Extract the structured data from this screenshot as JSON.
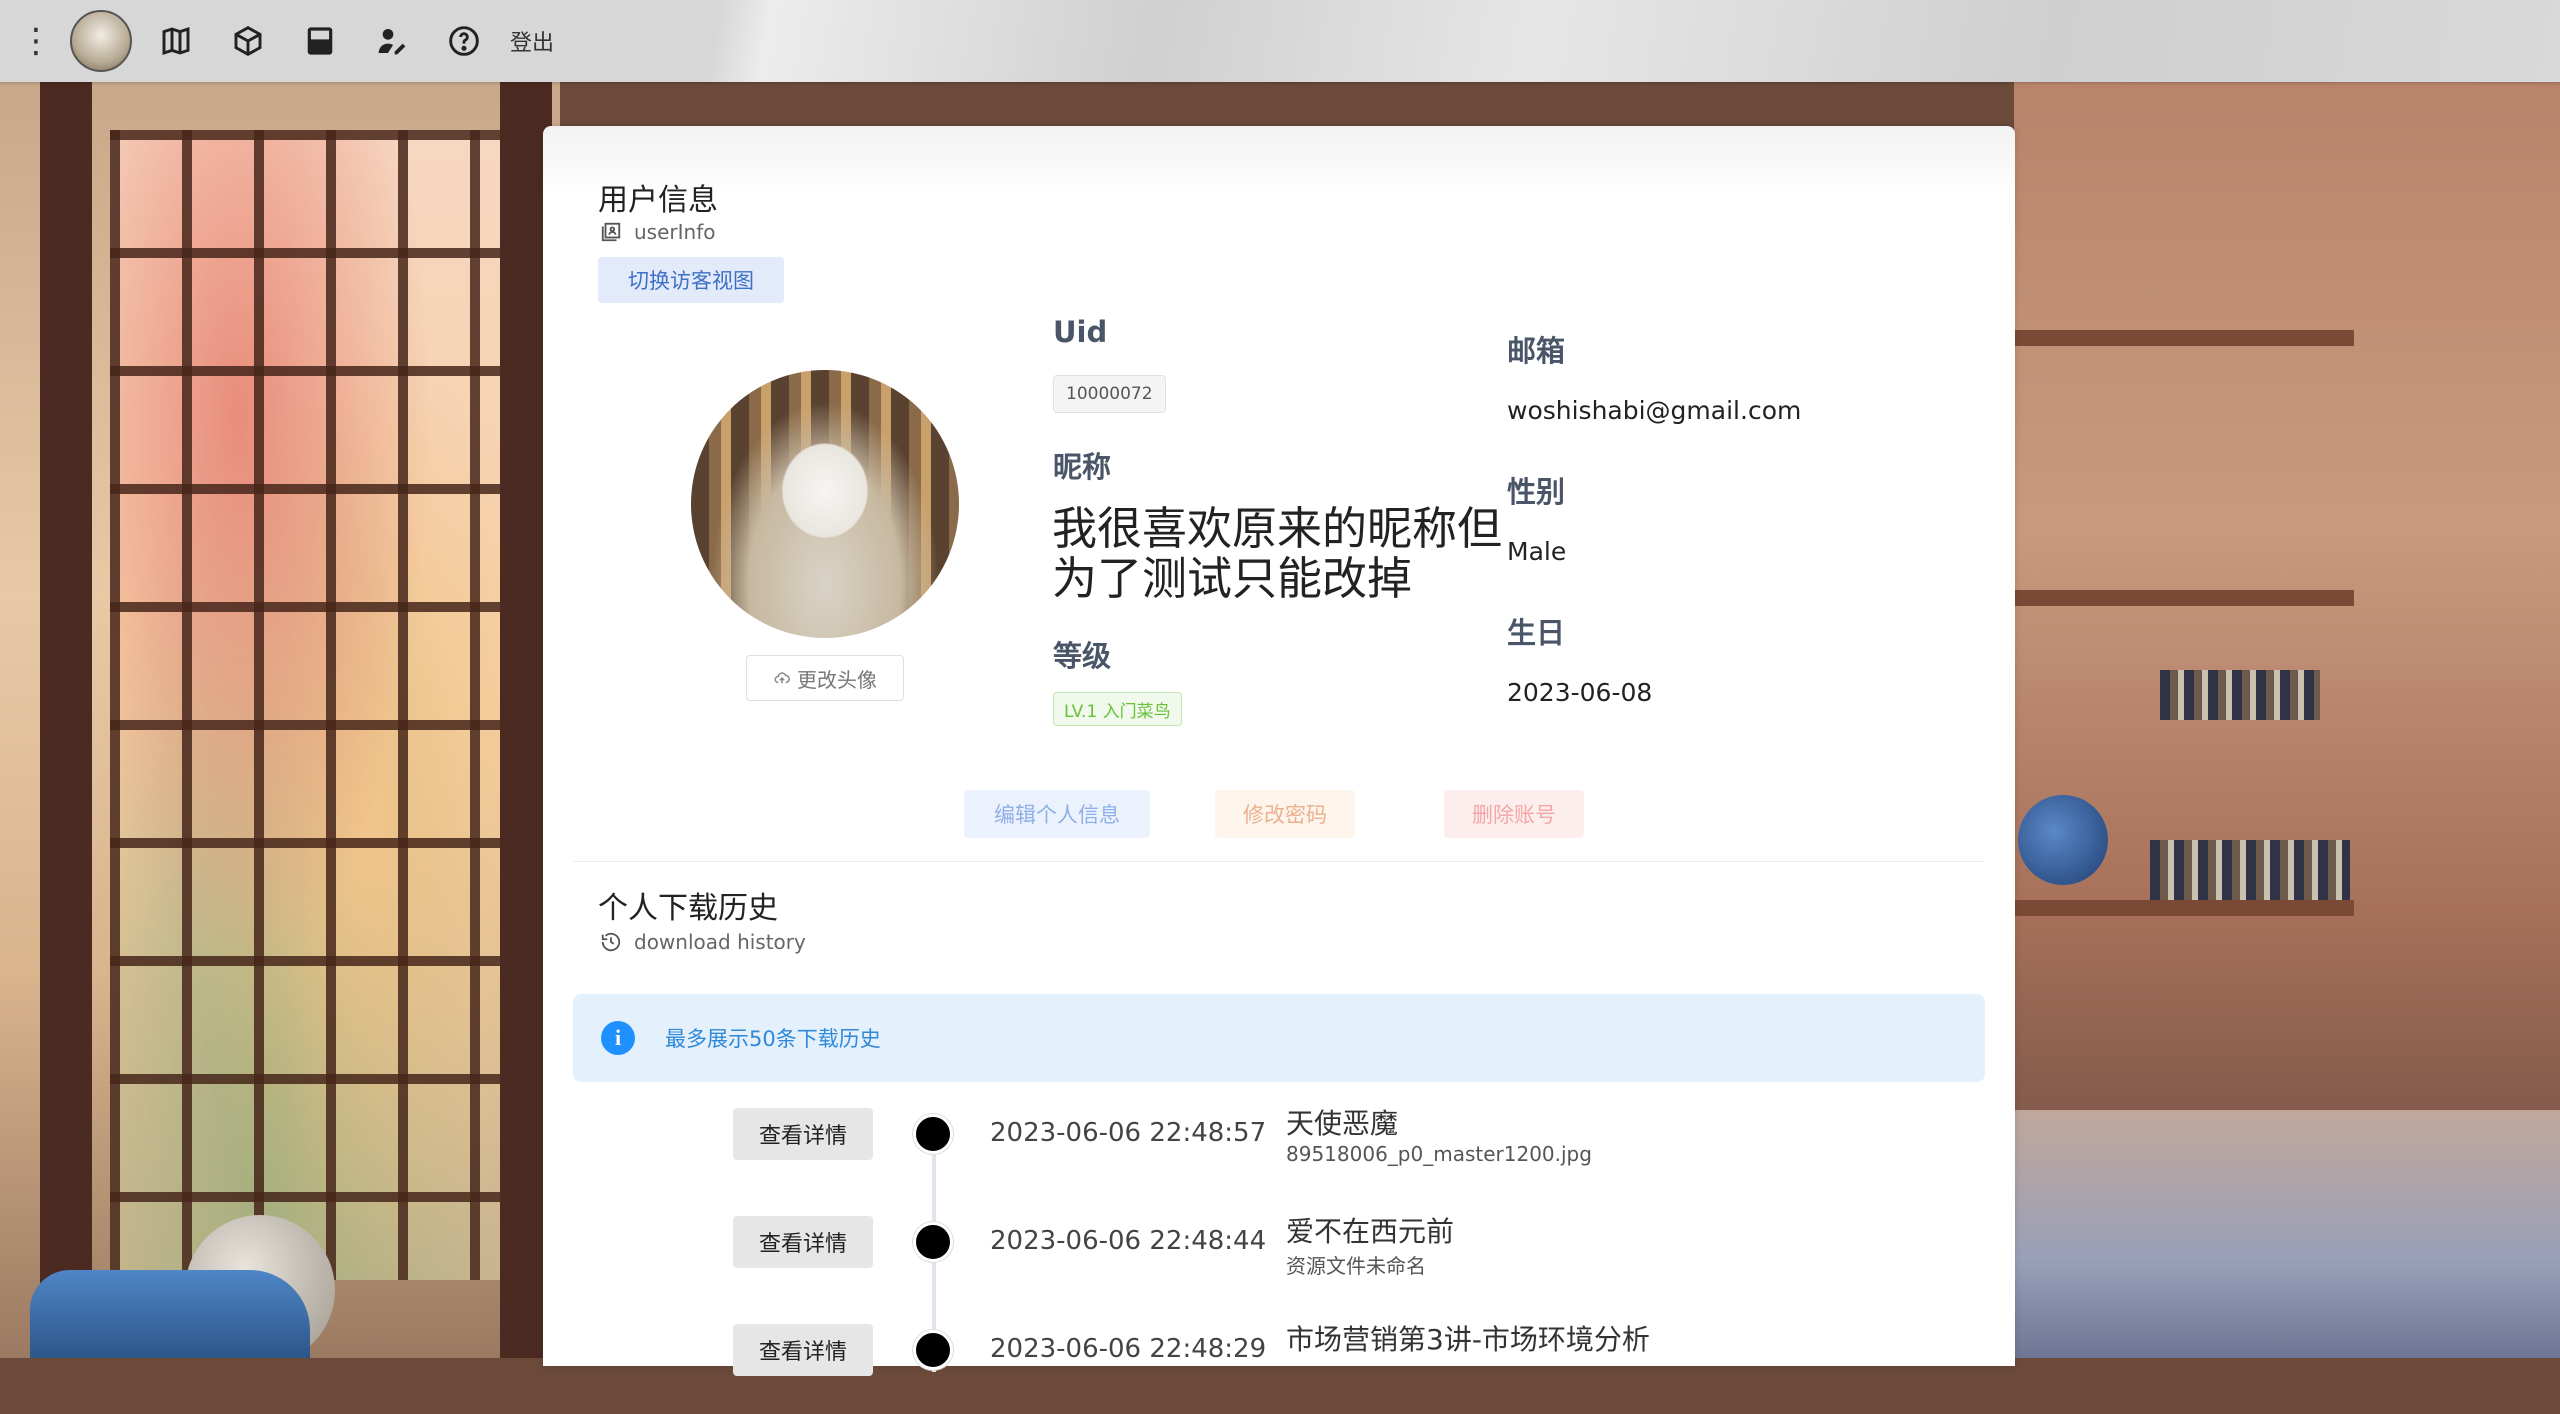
{
  "topbar": {
    "menu_icon": "more-vertical-icon",
    "nav_icons": [
      "map-icon",
      "cube-icon",
      "archive-icon",
      "user-edit-icon",
      "help-icon"
    ],
    "logout_label": "登出"
  },
  "user_section": {
    "title": "用户信息",
    "subtitle": "userInfo",
    "switch_view_button": "切换访客视图",
    "change_avatar_button": "更改头像",
    "uid_label": "Uid",
    "uid_value": "10000072",
    "nickname_label": "昵称",
    "nickname_value": "我很喜欢原来的昵称但为了测试只能改掉",
    "level_label": "等级",
    "level_value": "LV.1 入门菜鸟",
    "email_label": "邮箱",
    "email_value": "woshishabi@gmail.com",
    "gender_label": "性别",
    "gender_value": "Male",
    "birthday_label": "生日",
    "birthday_value": "2023-06-08",
    "edit_button": "编辑个人信息",
    "password_button": "修改密码",
    "delete_button": "删除账号"
  },
  "history_section": {
    "title": "个人下载历史",
    "subtitle": "download history",
    "alert_text": "最多展示50条下载历史",
    "detail_button": "查看详情",
    "items": [
      {
        "time": "2023-06-06 22:48:57",
        "title": "天使恶魔",
        "file": "89518006_p0_master1200.jpg"
      },
      {
        "time": "2023-06-06 22:48:44",
        "title": "爱不在西元前",
        "file": "资源文件未命名"
      },
      {
        "time": "2023-06-06 22:48:29",
        "title": "市场营销第3讲-市场环境分析",
        "file": ""
      }
    ]
  },
  "colors": {
    "primary": "#3f70c8",
    "warning": "#eab28e",
    "danger": "#f3a6a6",
    "success": "#67c23a",
    "info": "#1e90ff"
  }
}
